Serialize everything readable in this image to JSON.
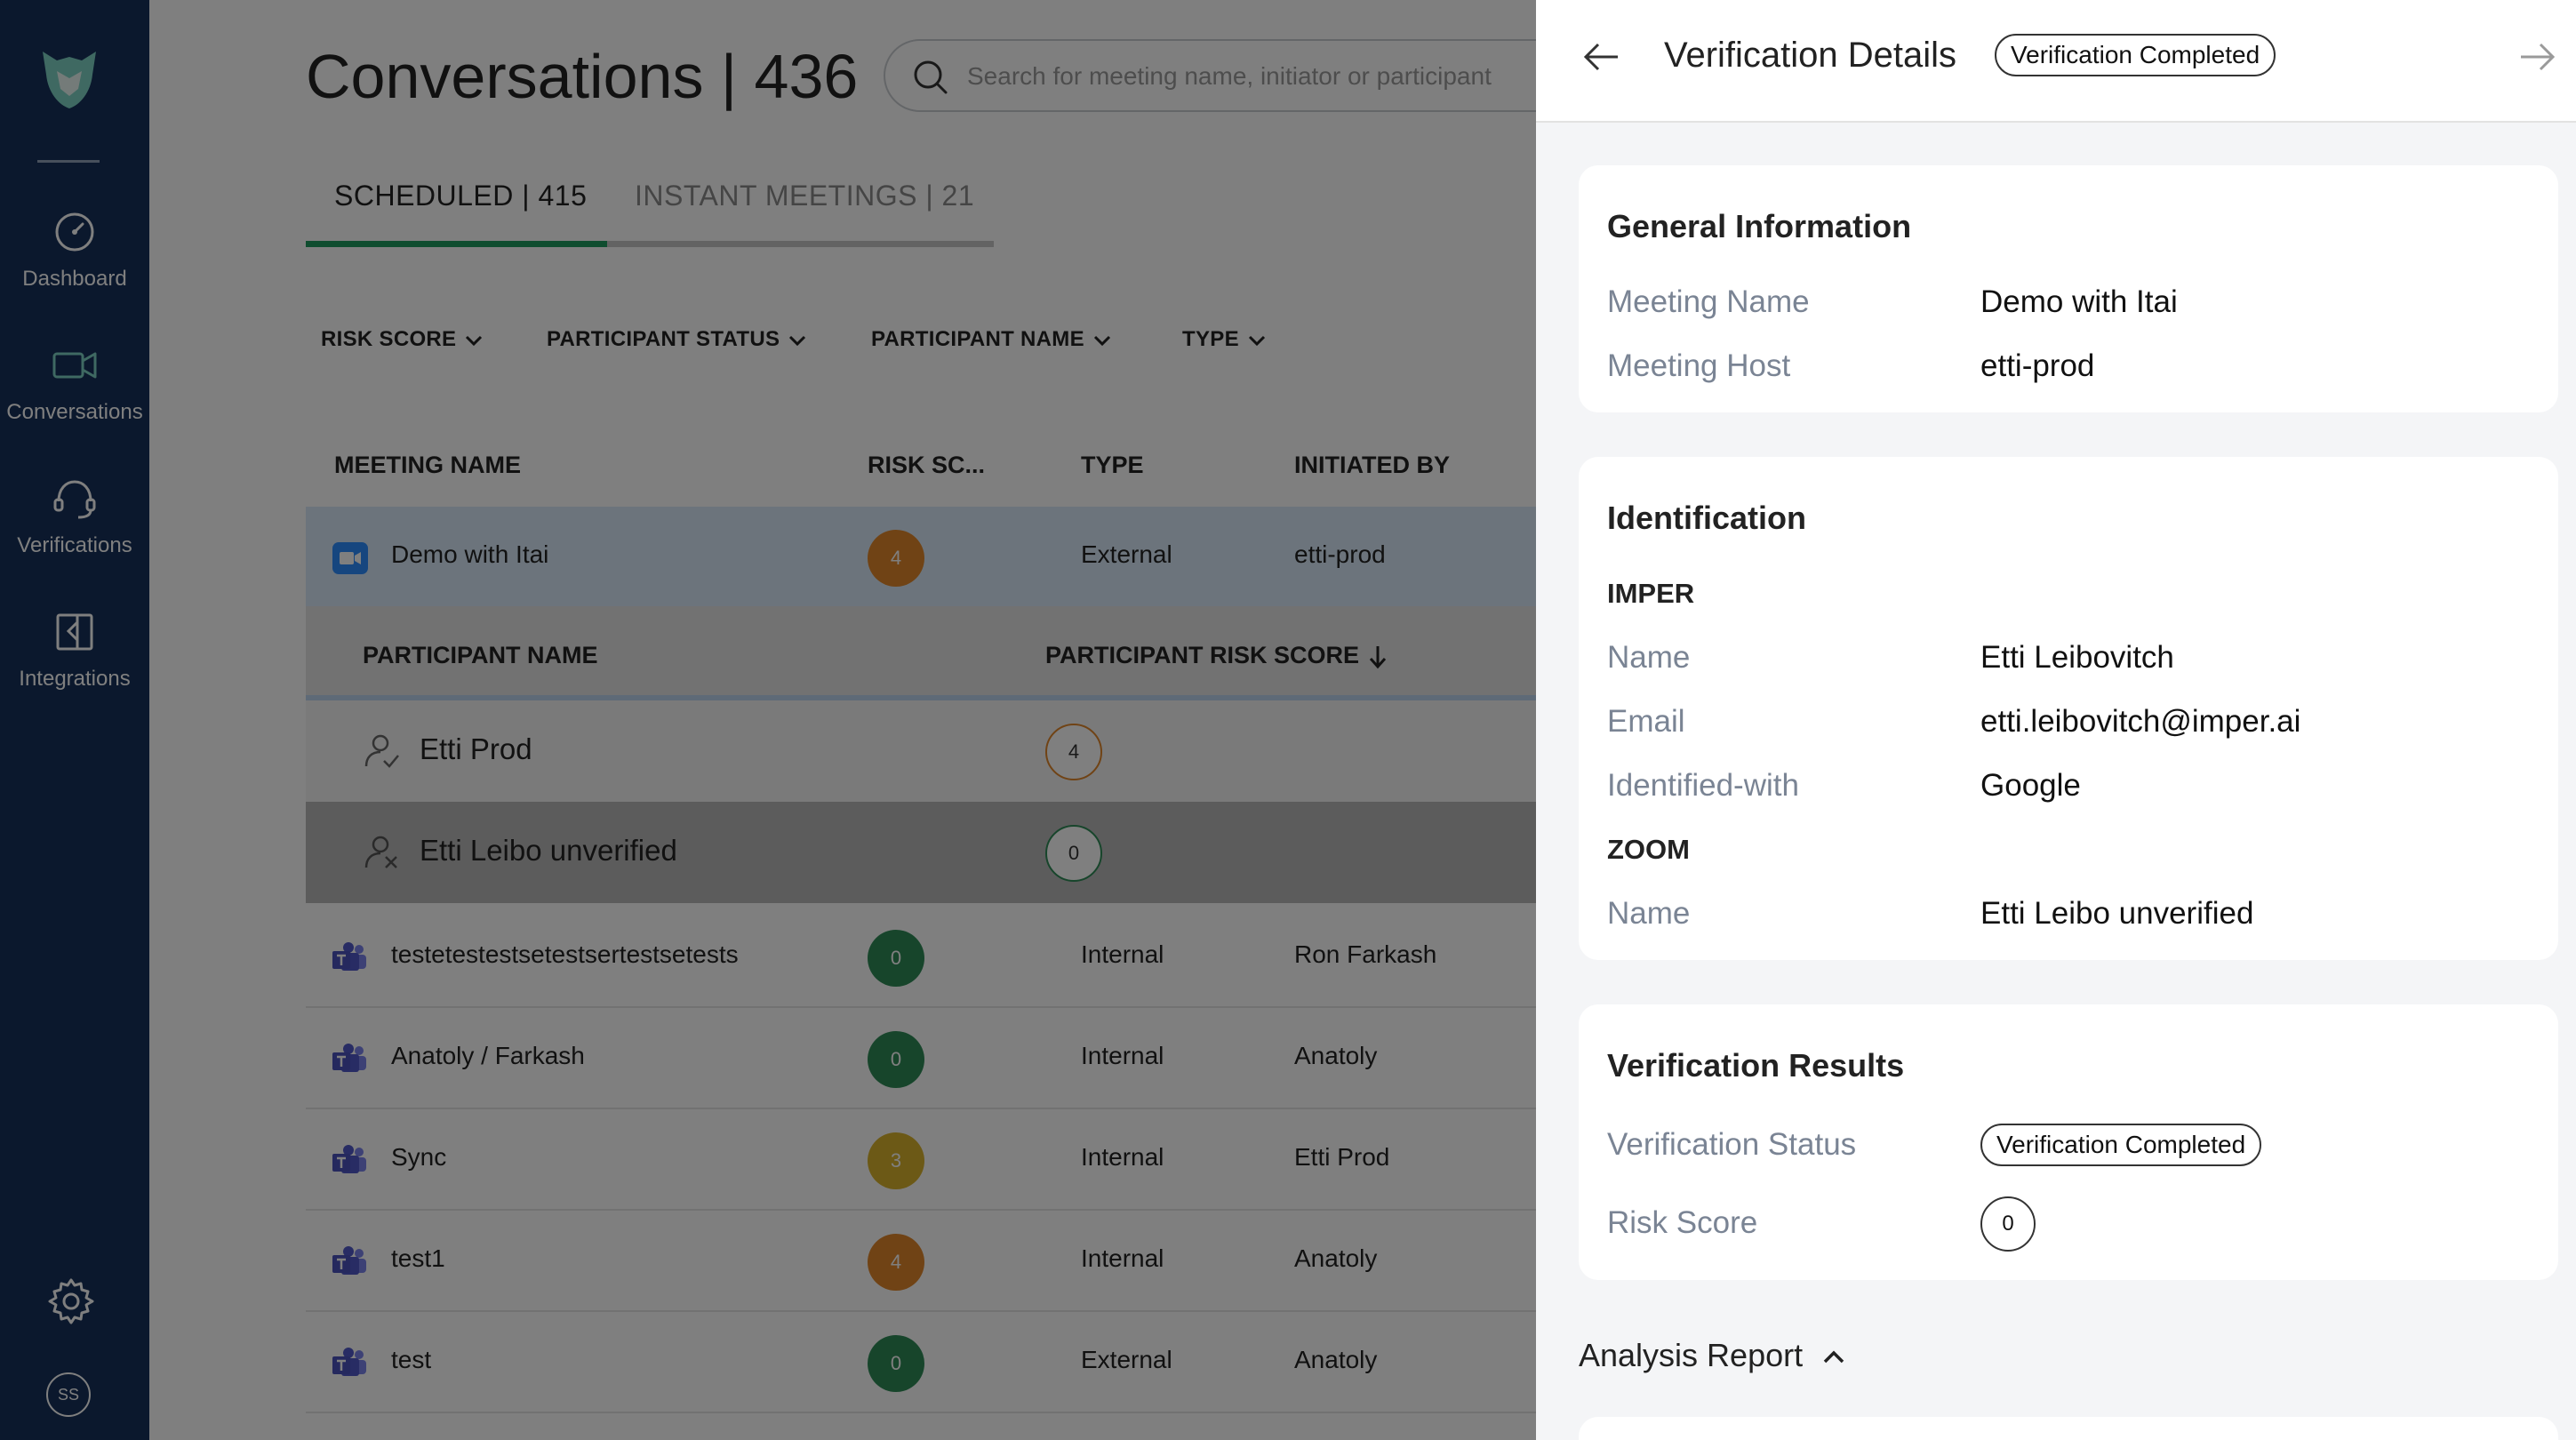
{
  "sidebar": {
    "items": [
      {
        "label": "Dashboard"
      },
      {
        "label": "Conversations"
      },
      {
        "label": "Verifications"
      },
      {
        "label": "Integrations"
      }
    ],
    "avatar_initials": "SS"
  },
  "main": {
    "title": "Conversations | 436",
    "search": {
      "placeholder": "Search for meeting name, initiator or participant"
    },
    "tabs": [
      {
        "label": "SCHEDULED | 415",
        "active": true
      },
      {
        "label": "INSTANT MEETINGS | 21",
        "active": false
      }
    ],
    "filters": [
      "RISK SCORE",
      "PARTICIPANT STATUS",
      "PARTICIPANT NAME",
      "TYPE"
    ],
    "columns": [
      "MEETING NAME",
      "RISK SC...",
      "TYPE",
      "INITIATED BY"
    ],
    "expanded": {
      "meeting": {
        "name": "Demo with Itai",
        "risk": "4",
        "risk_color": "#e0872a",
        "type": "External",
        "initiated_by": "etti-prod"
      },
      "sub_columns": [
        "PARTICIPANT NAME",
        "PARTICIPANT RISK SCORE"
      ],
      "participants": [
        {
          "name": "Etti Prod",
          "score": "4",
          "score_color": "#e0872a"
        },
        {
          "name": "Etti Leibo unverified",
          "score": "0",
          "score_color": "#2e8b57"
        }
      ]
    },
    "rows": [
      {
        "name": "testetestestsetestsertestsetests",
        "risk": "0",
        "risk_color": "#2e8b57",
        "type": "Internal",
        "initiated_by": "Ron Farkash"
      },
      {
        "name": "Anatoly / Farkash",
        "risk": "0",
        "risk_color": "#2e8b57",
        "type": "Internal",
        "initiated_by": "Anatoly"
      },
      {
        "name": "Sync",
        "risk": "3",
        "risk_color": "#d9b22c",
        "type": "Internal",
        "initiated_by": "Etti Prod"
      },
      {
        "name": "test1",
        "risk": "4",
        "risk_color": "#e0872a",
        "type": "Internal",
        "initiated_by": "Anatoly"
      },
      {
        "name": "test",
        "risk": "0",
        "risk_color": "#2e8b57",
        "type": "External",
        "initiated_by": "Anatoly"
      }
    ]
  },
  "panel": {
    "title": "Verification Details",
    "status_pill": "Verification Completed",
    "general": {
      "title": "General Information",
      "fields": [
        {
          "label": "Meeting Name",
          "value": "Demo with Itai"
        },
        {
          "label": "Meeting Host",
          "value": "etti-prod"
        }
      ]
    },
    "identification": {
      "title": "Identification",
      "imper": {
        "title": "IMPER",
        "fields": [
          {
            "label": "Name",
            "value": "Etti Leibovitch"
          },
          {
            "label": "Email",
            "value": "etti.leibovitch@imper.ai"
          },
          {
            "label": "Identified-with",
            "value": "Google"
          }
        ]
      },
      "zoom": {
        "title": "ZOOM",
        "fields": [
          {
            "label": "Name",
            "value": "Etti Leibo unverified"
          }
        ]
      }
    },
    "results": {
      "title": "Verification Results",
      "status_label": "Verification Status",
      "status_value": "Verification Completed",
      "risk_label": "Risk Score",
      "risk_value": "0"
    },
    "analysis": {
      "title": "Analysis Report"
    }
  },
  "colors": {
    "sidebar_bg": "#16305a",
    "accent_green": "#1e9a5e",
    "zoom_blue": "#2d8cff",
    "teams_purple": "#5059c9"
  }
}
